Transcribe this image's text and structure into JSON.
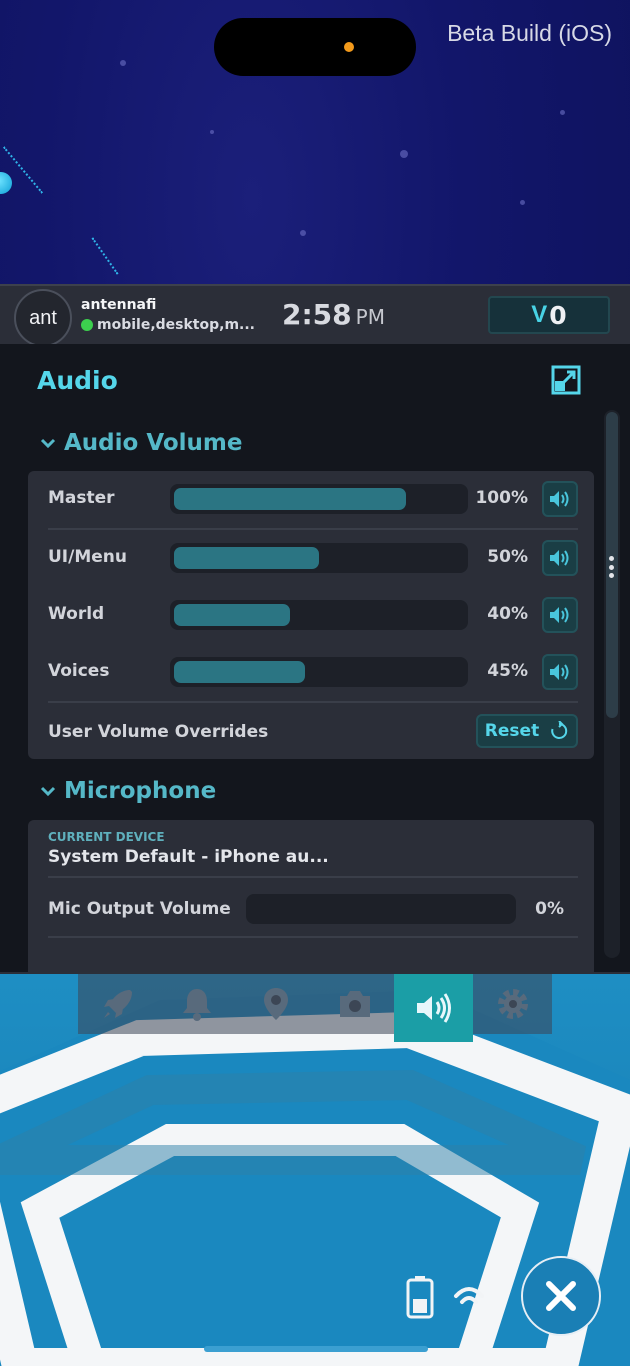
{
  "system": {
    "build_label": "Beta Build (iOS)"
  },
  "user": {
    "avatar_text": "ant",
    "username": "antennafi",
    "status": "mobile,desktop,m...",
    "status_color": "#3ccf4e"
  },
  "clock": {
    "time": "2:58",
    "ampm": "PM"
  },
  "currency": {
    "symbol": "V",
    "amount": "0"
  },
  "panel": {
    "title": "Audio",
    "pop_out_icon": "expand-icon"
  },
  "audio_volume": {
    "heading": "Audio Volume",
    "rows": [
      {
        "label": "Master",
        "percent_text": "100%",
        "level": 0.8
      },
      {
        "label": "UI/Menu",
        "percent_text": "50%",
        "level": 0.5
      },
      {
        "label": "World",
        "percent_text": "40%",
        "level": 0.4
      },
      {
        "label": "Voices",
        "percent_text": "45%",
        "level": 0.45
      }
    ],
    "overrides_label": "User Volume Overrides",
    "reset_label": "Reset"
  },
  "microphone": {
    "heading": "Microphone",
    "device_caption": "CURRENT DEVICE",
    "device_name": "System Default - iPhone au...",
    "output_label": "Mic Output Volume",
    "output_percent_text": "0%",
    "output_level": 0
  },
  "dock": {
    "items": [
      "rocket-icon",
      "bell-icon",
      "map-pin-icon",
      "camera-icon",
      "speaker-icon",
      "gear-icon"
    ],
    "active": "speaker-icon"
  },
  "colors": {
    "accent": "#55d6ea",
    "section_heading": "#55b8c8",
    "slider_fill": "#2b7583",
    "active_tab": "#1b9ea6"
  }
}
